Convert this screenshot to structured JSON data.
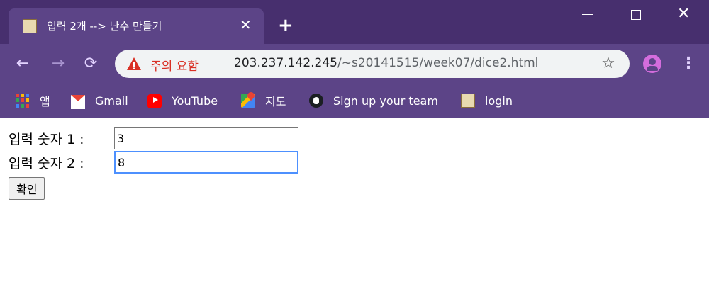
{
  "tab": {
    "title": "입력 2개 --> 난수 만들기",
    "close_glyph": "✕",
    "new_tab_glyph": "+"
  },
  "window": {
    "close_glyph": "✕"
  },
  "omnibox": {
    "security_label": "주의 요함",
    "url_host": "203.237.142.245",
    "url_path": "/~s20141515/week07/dice2.html",
    "star_glyph": "☆"
  },
  "nav": {
    "back_glyph": "←",
    "forward_glyph": "→",
    "reload_glyph": "⟳",
    "menu_glyph": "⋮"
  },
  "bookmarks": [
    {
      "label": "앱",
      "icon": "apps-icon"
    },
    {
      "label": "Gmail",
      "icon": "gmail-icon"
    },
    {
      "label": "YouTube",
      "icon": "youtube-icon"
    },
    {
      "label": "지도",
      "icon": "maps-icon"
    },
    {
      "label": "Sign up your team",
      "icon": "github-icon"
    },
    {
      "label": "login",
      "icon": "page-icon"
    }
  ],
  "colors": {
    "frame": "#472f6e",
    "toolbar": "#5c4487",
    "warning": "#d93025",
    "focus": "#4d90fe"
  },
  "form": {
    "input1": {
      "label": "입력 숫자 1 :",
      "value": "3"
    },
    "input2": {
      "label": "입력 숫자 2 :",
      "value": "8"
    },
    "submit_label": "확인"
  }
}
